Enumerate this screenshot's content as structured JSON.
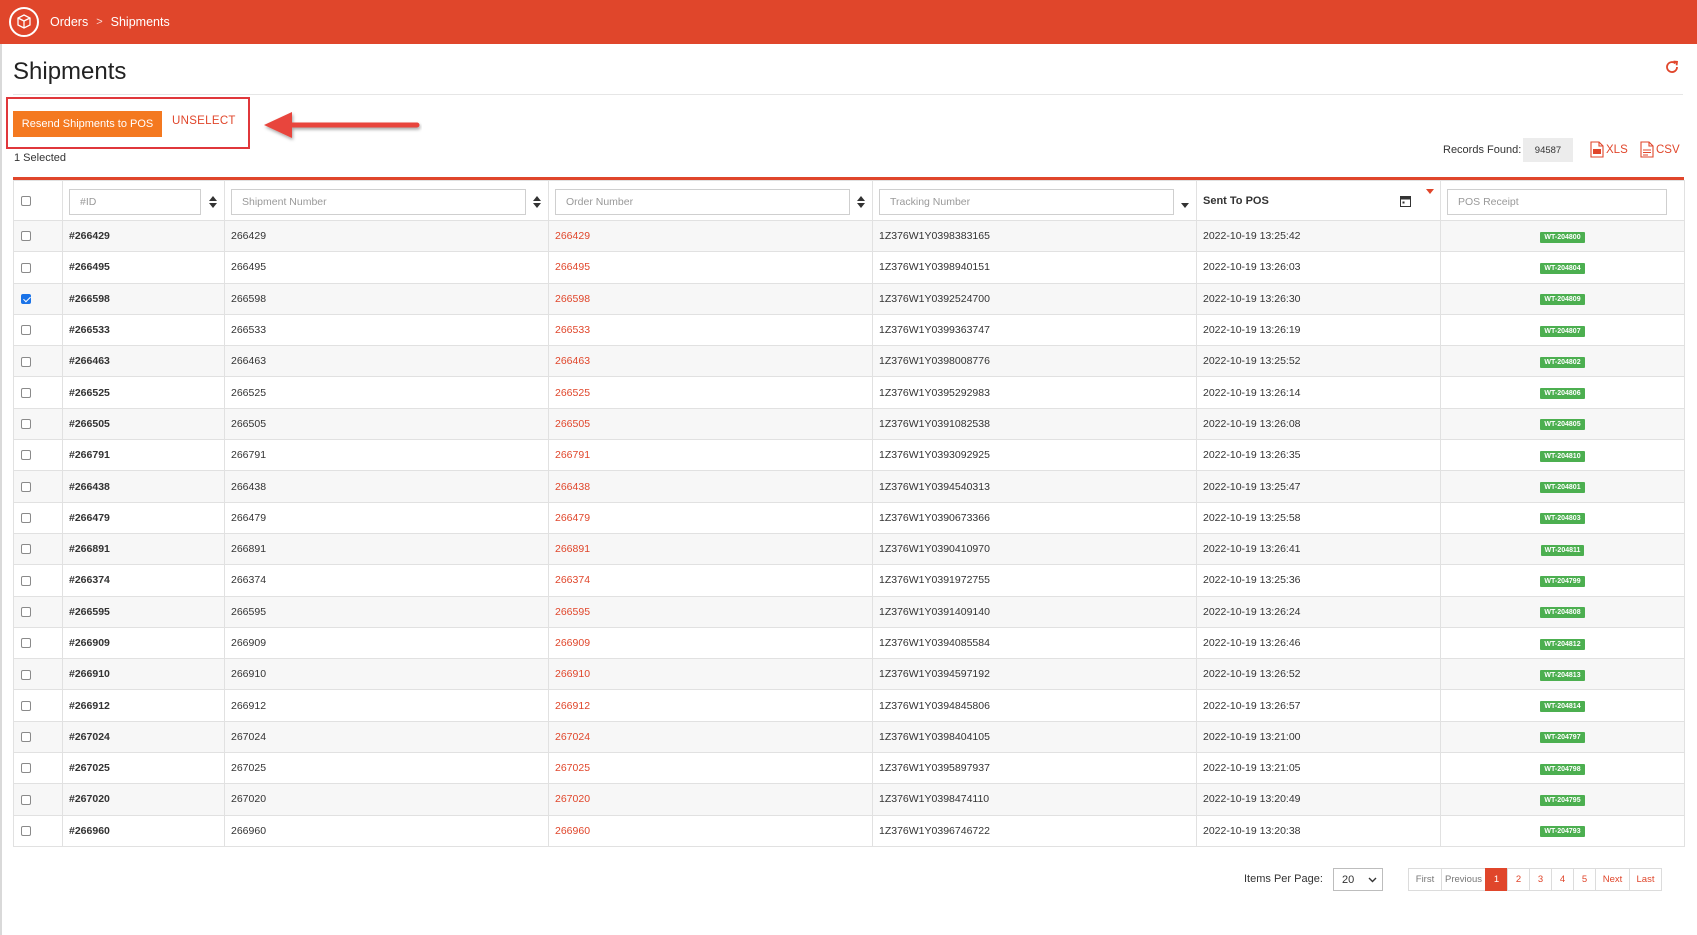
{
  "breadcrumb": {
    "parent": "Orders",
    "current": "Shipments"
  },
  "icons": {
    "logo": "box-logo-icon",
    "refresh": "refresh-icon",
    "calendar": "calendar-icon",
    "sort": "sort-icon",
    "xls": "xls-file-icon",
    "csv": "csv-file-icon"
  },
  "colors": {
    "brand": "#e0462b",
    "button": "#f47920",
    "badge": "#4caf50",
    "highlight": "#e0373b"
  },
  "page_title": "Shipments",
  "actions": {
    "resend_label": "Resend Shipments to POS",
    "unselect_label": "UNSELECT",
    "selected_count": "1 Selected"
  },
  "records": {
    "label": "Records Found:",
    "value": "94587"
  },
  "export": {
    "xls": "XLS",
    "csv": "CSV"
  },
  "table": {
    "filters": {
      "id": "#ID",
      "shipment": "Shipment Number",
      "order": "Order Number",
      "tracking": "Tracking Number",
      "sent": "Sent To POS",
      "receipt": "POS Receipt"
    },
    "rows": [
      {
        "id": "#266429",
        "shipment": "266429",
        "order": "266429",
        "tracking": "1Z376W1Y0398383165",
        "sent": "2022-10-19 13:25:42",
        "receipt": "WT-204800",
        "checked": false
      },
      {
        "id": "#266495",
        "shipment": "266495",
        "order": "266495",
        "tracking": "1Z376W1Y0398940151",
        "sent": "2022-10-19 13:26:03",
        "receipt": "WT-204804",
        "checked": false
      },
      {
        "id": "#266598",
        "shipment": "266598",
        "order": "266598",
        "tracking": "1Z376W1Y0392524700",
        "sent": "2022-10-19 13:26:30",
        "receipt": "WT-204809",
        "checked": true
      },
      {
        "id": "#266533",
        "shipment": "266533",
        "order": "266533",
        "tracking": "1Z376W1Y0399363747",
        "sent": "2022-10-19 13:26:19",
        "receipt": "WT-204807",
        "checked": false
      },
      {
        "id": "#266463",
        "shipment": "266463",
        "order": "266463",
        "tracking": "1Z376W1Y0398008776",
        "sent": "2022-10-19 13:25:52",
        "receipt": "WT-204802",
        "checked": false
      },
      {
        "id": "#266525",
        "shipment": "266525",
        "order": "266525",
        "tracking": "1Z376W1Y0395292983",
        "sent": "2022-10-19 13:26:14",
        "receipt": "WT-204806",
        "checked": false
      },
      {
        "id": "#266505",
        "shipment": "266505",
        "order": "266505",
        "tracking": "1Z376W1Y0391082538",
        "sent": "2022-10-19 13:26:08",
        "receipt": "WT-204805",
        "checked": false
      },
      {
        "id": "#266791",
        "shipment": "266791",
        "order": "266791",
        "tracking": "1Z376W1Y0393092925",
        "sent": "2022-10-19 13:26:35",
        "receipt": "WT-204810",
        "checked": false
      },
      {
        "id": "#266438",
        "shipment": "266438",
        "order": "266438",
        "tracking": "1Z376W1Y0394540313",
        "sent": "2022-10-19 13:25:47",
        "receipt": "WT-204801",
        "checked": false
      },
      {
        "id": "#266479",
        "shipment": "266479",
        "order": "266479",
        "tracking": "1Z376W1Y0390673366",
        "sent": "2022-10-19 13:25:58",
        "receipt": "WT-204803",
        "checked": false
      },
      {
        "id": "#266891",
        "shipment": "266891",
        "order": "266891",
        "tracking": "1Z376W1Y0390410970",
        "sent": "2022-10-19 13:26:41",
        "receipt": "WT-204811",
        "checked": false
      },
      {
        "id": "#266374",
        "shipment": "266374",
        "order": "266374",
        "tracking": "1Z376W1Y0391972755",
        "sent": "2022-10-19 13:25:36",
        "receipt": "WT-204799",
        "checked": false
      },
      {
        "id": "#266595",
        "shipment": "266595",
        "order": "266595",
        "tracking": "1Z376W1Y0391409140",
        "sent": "2022-10-19 13:26:24",
        "receipt": "WT-204808",
        "checked": false
      },
      {
        "id": "#266909",
        "shipment": "266909",
        "order": "266909",
        "tracking": "1Z376W1Y0394085584",
        "sent": "2022-10-19 13:26:46",
        "receipt": "WT-204812",
        "checked": false
      },
      {
        "id": "#266910",
        "shipment": "266910",
        "order": "266910",
        "tracking": "1Z376W1Y0394597192",
        "sent": "2022-10-19 13:26:52",
        "receipt": "WT-204813",
        "checked": false
      },
      {
        "id": "#266912",
        "shipment": "266912",
        "order": "266912",
        "tracking": "1Z376W1Y0394845806",
        "sent": "2022-10-19 13:26:57",
        "receipt": "WT-204814",
        "checked": false
      },
      {
        "id": "#267024",
        "shipment": "267024",
        "order": "267024",
        "tracking": "1Z376W1Y0398404105",
        "sent": "2022-10-19 13:21:00",
        "receipt": "WT-204797",
        "checked": false
      },
      {
        "id": "#267025",
        "shipment": "267025",
        "order": "267025",
        "tracking": "1Z376W1Y0395897937",
        "sent": "2022-10-19 13:21:05",
        "receipt": "WT-204798",
        "checked": false
      },
      {
        "id": "#267020",
        "shipment": "267020",
        "order": "267020",
        "tracking": "1Z376W1Y0398474110",
        "sent": "2022-10-19 13:20:49",
        "receipt": "WT-204795",
        "checked": false
      },
      {
        "id": "#266960",
        "shipment": "266960",
        "order": "266960",
        "tracking": "1Z376W1Y0396746722",
        "sent": "2022-10-19 13:20:38",
        "receipt": "WT-204793",
        "checked": false
      }
    ]
  },
  "pagination": {
    "items_per_page_label": "Items Per Page:",
    "items_per_page_value": "20",
    "first": "First",
    "previous": "Previous",
    "pages": [
      "1",
      "2",
      "3",
      "4",
      "5"
    ],
    "current": "1",
    "next": "Next",
    "last": "Last"
  }
}
